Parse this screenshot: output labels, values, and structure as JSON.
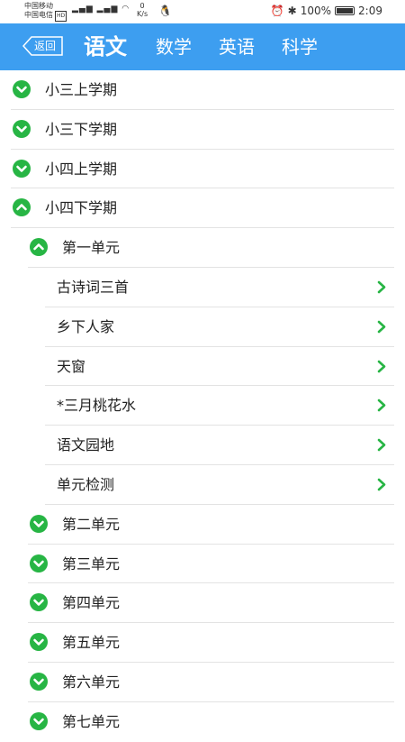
{
  "status_bar": {
    "carrier1": "中国移动",
    "carrier2": "中国电信",
    "hd": "HD",
    "speed_value": "0",
    "speed_unit": "K/s",
    "battery_pct": "100%",
    "time": "2:09"
  },
  "app_bar": {
    "back_label": "返回",
    "tabs": [
      {
        "label": "语文",
        "active": true
      },
      {
        "label": "数学",
        "active": false
      },
      {
        "label": "英语",
        "active": false
      },
      {
        "label": "科学",
        "active": false
      }
    ]
  },
  "colors": {
    "primary": "#3d9ef0",
    "accent_green": "#27b544"
  },
  "list": {
    "semesters": [
      {
        "label": "小三上学期",
        "expanded": false
      },
      {
        "label": "小三下学期",
        "expanded": false
      },
      {
        "label": "小四上学期",
        "expanded": false
      },
      {
        "label": "小四下学期",
        "expanded": true
      }
    ],
    "units": [
      {
        "label": "第一单元",
        "expanded": true
      },
      {
        "label": "第二单元",
        "expanded": false
      },
      {
        "label": "第三单元",
        "expanded": false
      },
      {
        "label": "第四单元",
        "expanded": false
      },
      {
        "label": "第五单元",
        "expanded": false
      },
      {
        "label": "第六单元",
        "expanded": false
      },
      {
        "label": "第七单元",
        "expanded": false
      }
    ],
    "lessons": [
      {
        "label": "古诗词三首"
      },
      {
        "label": "乡下人家"
      },
      {
        "label": "天窗"
      },
      {
        "label": "*三月桃花水"
      },
      {
        "label": "语文园地"
      },
      {
        "label": "单元检测"
      }
    ]
  }
}
